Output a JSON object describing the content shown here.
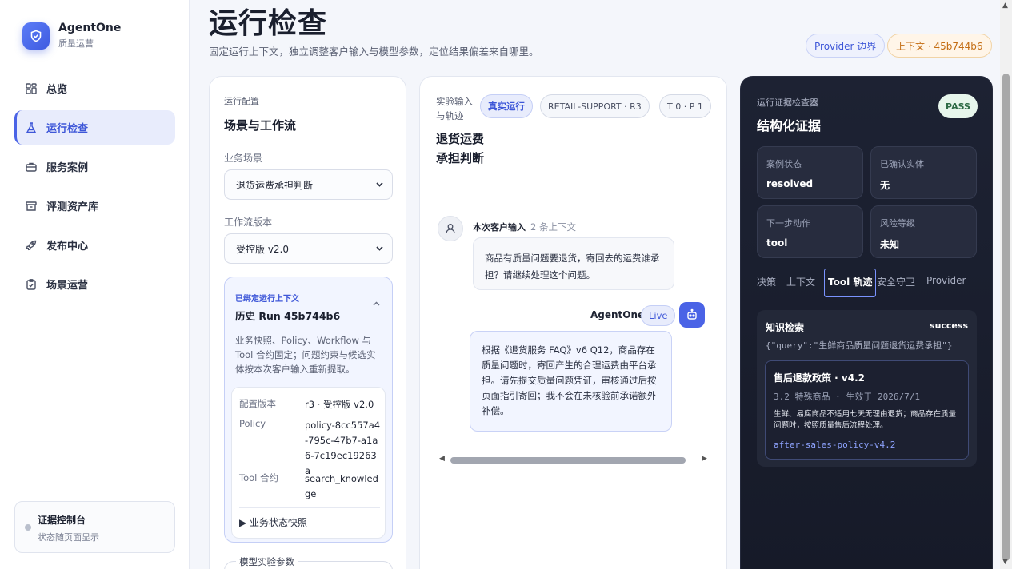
{
  "brand": {
    "name": "AgentOne",
    "subtitle": "质量运营"
  },
  "nav": [
    {
      "label": "总览",
      "icon": "grid-icon"
    },
    {
      "label": "运行检查",
      "icon": "flask-icon"
    },
    {
      "label": "服务案例",
      "icon": "briefcase-icon"
    },
    {
      "label": "评测资产库",
      "icon": "archive-icon"
    },
    {
      "label": "发布中心",
      "icon": "rocket-icon"
    },
    {
      "label": "场景运营",
      "icon": "clipboard-icon"
    }
  ],
  "console": {
    "title": "证据控制台",
    "subtitle": "状态随页面显示"
  },
  "header": {
    "title": "运行检查",
    "subtitle": "固定运行上下文，独立调整客户输入与模型参数，定位结果偏差来自哪里。",
    "provider_chip": "Provider 边界",
    "context_chip": "上下文 · 45b744b6"
  },
  "config": {
    "eyebrow": "运行配置",
    "title": "场景与工作流",
    "scenario_label": "业务场景",
    "scenario_value": "退货运费承担判断",
    "workflow_label": "工作流版本",
    "workflow_value": "受控版 v2.0",
    "bound": {
      "eyebrow": "已绑定运行上下文",
      "title": "历史 Run 45b744b6",
      "description": "业务快照、Policy、Workflow 与 Tool 合约固定；问题约束与候选实体按本次客户输入重新提取。",
      "rows": [
        {
          "key": "配置版本",
          "value": "r3 · 受控版 v2.0"
        },
        {
          "key": "Policy",
          "value": "policy-8cc557a4-795c-47b7-a1a6-7c19ec19263a"
        },
        {
          "key": "Tool 合约",
          "value": "search_knowledge"
        }
      ],
      "snapshot_label": "▶ 业务状态快照"
    },
    "model_params_label": "模型实验参数"
  },
  "experiment": {
    "eyebrow": "实验输入与轨迹",
    "title": "退货运费承担判断",
    "pills": [
      "真实运行",
      "RETAIL-SUPPORT · R3",
      "T 0 · P 1"
    ],
    "user_head": "本次客户输入",
    "user_ctx": "2 条上下文",
    "user_message": "商品有质量问题要退货，寄回去的运费谁承担？请继续处理这个问题。",
    "agent_name": "AgentOne",
    "agent_badge": "Live",
    "agent_message": "根据《退货服务 FAQ》v6 Q12，商品存在质量问题时，寄回产生的合理运费由平台承担。请先提交质量问题凭证，审核通过后按页面指引寄回；我不会在未核验前承诺额外补偿。"
  },
  "evidence": {
    "eyebrow": "运行证据检查器",
    "title": "结构化证据",
    "status": "PASS",
    "tiles": [
      {
        "key": "案例状态",
        "value": "resolved"
      },
      {
        "key": "已确认实体",
        "value": "无"
      },
      {
        "key": "下一步动作",
        "value": "tool"
      },
      {
        "key": "风险等级",
        "value": "未知"
      }
    ],
    "tabs": [
      "决策",
      "上下文",
      "Tool 轨迹",
      "安全守卫",
      "Provider"
    ],
    "active_tab": "Tool 轨迹",
    "panel": {
      "title": "知识检索",
      "status": "success",
      "query": "{\"query\":\"生鲜商品质量问题退货运费承担\"}",
      "result_title": "售后退款政策 · v4.2",
      "result_meta": "3.2 特殊商品 · 生效于 2026/7/1",
      "result_desc": "生鲜、易腐商品不适用七天无理由退货；商品存在质量问题时，按照质量售后流程处理。",
      "result_id": "after-sales-policy-v4.2"
    }
  }
}
